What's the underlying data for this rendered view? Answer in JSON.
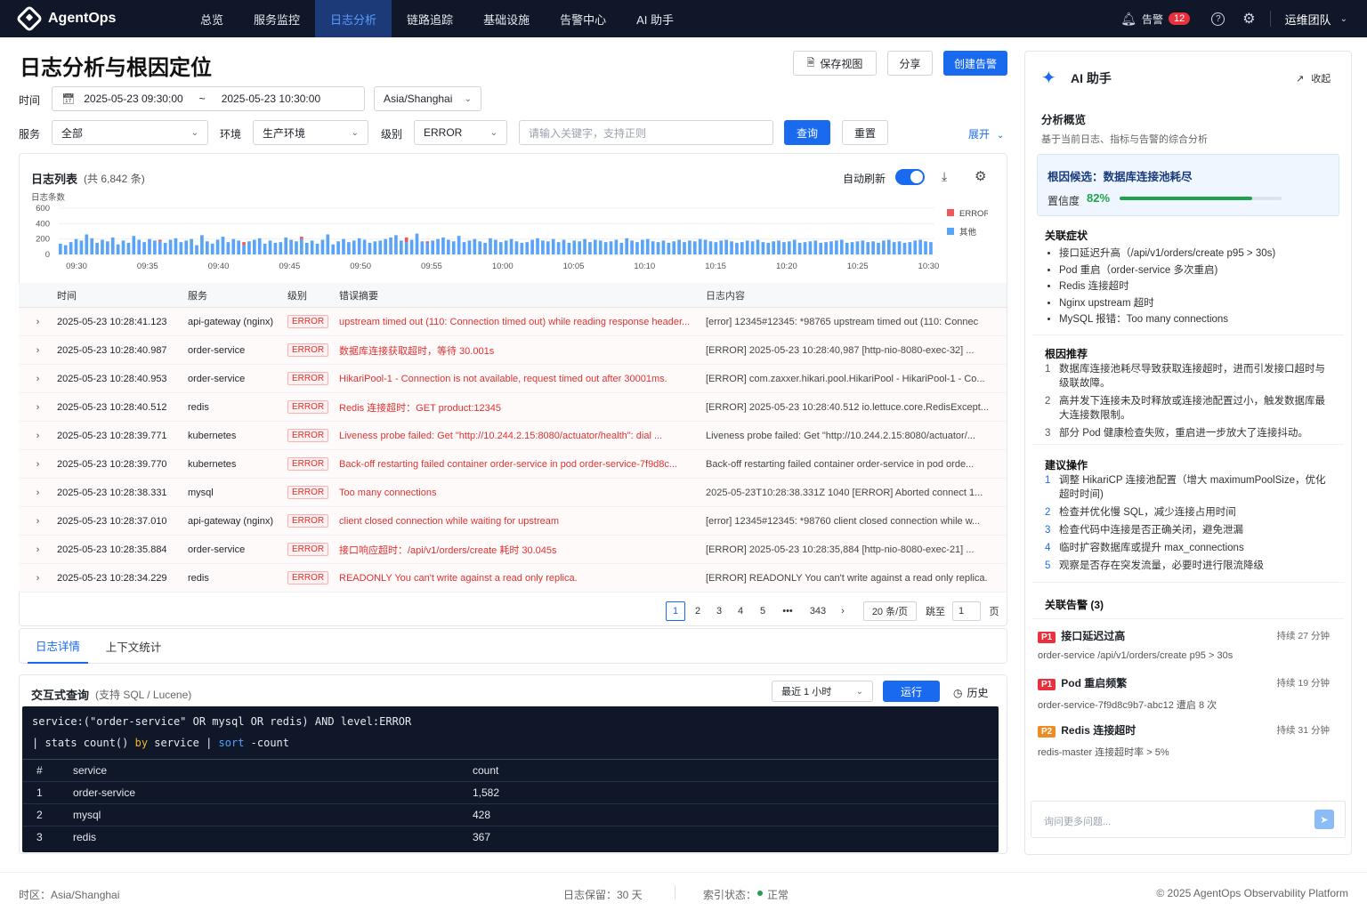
{
  "nav": {
    "brand": "AgentOps",
    "items": [
      "总览",
      "服务监控",
      "日志分析",
      "链路追踪",
      "基础设施",
      "告警中心",
      "AI 助手"
    ],
    "active_index": 2,
    "alert_label": "告警",
    "alert_count": "12",
    "team": "运维团队"
  },
  "page": {
    "title": "日志分析与根因定位",
    "save_view": "保存视图",
    "share": "分享",
    "create_alert": "创建告警"
  },
  "filters": {
    "time_label": "时间",
    "time_start": "2025-05-23 09:30:00",
    "time_sep": "~",
    "time_end": "2025-05-23 10:30:00",
    "timezone": "Asia/Shanghai",
    "service_label": "服务",
    "service_value": "全部",
    "env_label": "环境",
    "env_value": "生产环境",
    "level_label": "级别",
    "level_value": "ERROR",
    "search_placeholder": "请输入关键字，支持正则",
    "query_btn": "查询",
    "reset_btn": "重置",
    "expand": "展开"
  },
  "log_list": {
    "title": "日志列表",
    "count_text": "(共 6,842 条)",
    "auto_refresh_label": "自动刷新",
    "auto_refresh_on": true
  },
  "chart_data": {
    "type": "bar",
    "stacked": true,
    "ylabel": "日志条数",
    "y_ticks": [
      0,
      200,
      400,
      600
    ],
    "ylim": [
      0,
      600
    ],
    "x_ticks": [
      "09:30",
      "09:35",
      "09:40",
      "09:45",
      "09:50",
      "09:55",
      "10:00",
      "10:05",
      "10:10",
      "10:15",
      "10:20",
      "10:25",
      "10:30"
    ],
    "series": [
      {
        "name": "ERROR",
        "color": "#f0585b",
        "values": [
          0,
          0,
          0,
          0,
          0,
          0,
          0,
          0,
          0,
          0,
          0,
          0,
          0,
          0,
          0,
          0,
          0,
          0,
          0,
          20,
          0,
          0,
          0,
          0,
          0,
          0,
          0,
          0,
          0,
          0,
          0,
          0,
          0,
          0,
          0,
          40,
          0,
          0,
          0,
          0,
          0,
          0,
          0,
          0,
          0,
          0,
          30,
          0,
          0,
          0,
          0,
          0,
          0,
          0,
          0,
          0,
          0,
          0,
          0,
          0,
          0,
          0,
          0,
          0,
          0,
          0,
          60,
          0,
          0,
          0,
          20,
          0,
          0,
          0,
          0,
          0,
          0,
          0,
          0,
          0,
          0,
          0,
          0,
          0,
          0,
          0,
          0,
          0,
          0,
          0,
          0,
          0,
          0,
          0,
          0,
          0,
          0,
          0,
          0,
          0,
          0,
          0,
          0,
          0,
          0,
          0,
          0,
          0,
          0,
          0,
          0,
          0,
          0,
          0,
          0,
          0,
          0,
          0,
          0,
          0,
          0,
          0,
          0,
          0,
          0
        ]
      },
      {
        "name": "其他",
        "color": "#5aa4f8",
        "values": [
          140,
          120,
          160,
          200,
          180,
          260,
          210,
          150,
          190,
          170,
          220,
          130,
          180,
          150,
          240,
          190,
          160,
          200,
          180,
          170,
          150,
          190,
          210,
          160,
          180,
          200,
          120,
          250,
          170,
          140,
          190,
          230,
          160,
          200,
          180,
          120,
          170,
          190,
          210,
          140,
          180,
          150,
          160,
          220,
          190,
          170,
          200,
          150,
          180,
          140,
          190,
          260,
          130,
          170,
          200,
          160,
          180,
          210,
          190,
          150,
          170,
          180,
          200,
          220,
          250,
          180,
          160,
          190,
          270,
          170,
          150,
          180,
          200,
          220,
          190,
          170,
          240,
          160,
          180,
          200,
          170,
          150,
          210,
          190,
          160,
          180,
          200,
          170,
          150,
          160,
          190,
          210,
          180,
          170,
          200,
          160,
          190,
          150,
          180,
          170,
          200,
          160,
          190,
          180,
          160,
          170,
          190,
          150,
          210,
          180,
          160,
          190,
          200,
          170,
          160,
          180,
          150,
          170,
          190,
          160,
          180,
          170,
          200,
          190,
          170,
          160,
          180,
          190,
          170,
          150,
          160,
          180,
          170,
          190,
          160,
          150,
          170,
          180,
          160,
          170,
          190,
          150,
          160,
          170,
          180,
          150,
          160,
          170,
          180,
          190,
          150,
          160,
          170,
          180,
          160,
          170,
          150,
          180,
          190,
          160,
          170,
          150,
          160,
          180,
          190,
          170,
          160
        ]
      }
    ],
    "legend_position": "right"
  },
  "log_table": {
    "headers": [
      "时间",
      "服务",
      "级别",
      "错误摘要",
      "日志内容"
    ],
    "rows": [
      {
        "time": "2025-05-23 10:28:41.123",
        "service": "api-gateway (nginx)",
        "level": "ERROR",
        "summary": "upstream timed out (110: Connection timed out) while reading response header...",
        "content": "[error] 12345#12345: *98765 upstream timed out (110: Connec"
      },
      {
        "time": "2025-05-23 10:28:40.987",
        "service": "order-service",
        "level": "ERROR",
        "summary": "数据库连接获取超时，等待 30.001s",
        "content": "[ERROR] 2025-05-23 10:28:40,987 [http-nio-8080-exec-32] ..."
      },
      {
        "time": "2025-05-23 10:28:40.953",
        "service": "order-service",
        "level": "ERROR",
        "summary": "HikariPool-1 - Connection is not available, request timed out after 30001ms.",
        "content": "[ERROR] com.zaxxer.hikari.pool.HikariPool - HikariPool-1 - Co..."
      },
      {
        "time": "2025-05-23 10:28:40.512",
        "service": "redis",
        "level": "ERROR",
        "summary": "Redis 连接超时：GET product:12345",
        "content": "[ERROR] 2025-05-23 10:28:40.512 io.lettuce.core.RedisExcept..."
      },
      {
        "time": "2025-05-23 10:28:39.771",
        "service": "kubernetes",
        "level": "ERROR",
        "summary": "Liveness probe failed: Get \"http://10.244.2.15:8080/actuator/health\": dial ...",
        "content": "Liveness probe failed: Get \"http://10.244.2.15:8080/actuator/..."
      },
      {
        "time": "2025-05-23 10:28:39.770",
        "service": "kubernetes",
        "level": "ERROR",
        "summary": "Back-off restarting failed container order-service in pod order-service-7f9d8c...",
        "content": "Back-off restarting failed container order-service in pod orde..."
      },
      {
        "time": "2025-05-23 10:28:38.331",
        "service": "mysql",
        "level": "ERROR",
        "summary": "Too many connections",
        "content": "2025-05-23T10:28:38.331Z 1040 [ERROR] Aborted connect 1..."
      },
      {
        "time": "2025-05-23 10:28:37.010",
        "service": "api-gateway (nginx)",
        "level": "ERROR",
        "summary": "client closed connection while waiting for upstream",
        "content": "[error] 12345#12345: *98760 client closed connection while w..."
      },
      {
        "time": "2025-05-23 10:28:35.884",
        "service": "order-service",
        "level": "ERROR",
        "summary": "接口响应超时：/api/v1/orders/create 耗时 30.045s",
        "content": "[ERROR] 2025-05-23 10:28:35,884 [http-nio-8080-exec-21] ..."
      },
      {
        "time": "2025-05-23 10:28:34.229",
        "service": "redis",
        "level": "ERROR",
        "summary": "READONLY You can't write against a read only replica.",
        "content": "[ERROR] READONLY You can't write against a read only replica."
      }
    ]
  },
  "pagination": {
    "pages": [
      "1",
      "2",
      "3",
      "4",
      "5",
      "•••",
      "343"
    ],
    "current": "1",
    "page_size": "20 条/页",
    "jump_label": "跳至",
    "jump_value": "1",
    "page_unit": "页"
  },
  "detail_tabs": [
    "日志详情",
    "上下文统计"
  ],
  "query": {
    "title": "交互式查询",
    "subtitle": "(支持 SQL / Lucene)",
    "range": "最近 1 小时",
    "run": "运行",
    "history": "历史",
    "line1": "service:(\"order-service\" OR mysql OR redis) AND level:ERROR",
    "line2_a": "| stats count() ",
    "line2_by": "by",
    "line2_b": " service | ",
    "line2_sort": "sort",
    "line2_c": " -count",
    "headers": [
      "#",
      "service",
      "count"
    ],
    "rows": [
      {
        "n": "1",
        "service": "order-service",
        "count": "1,582"
      },
      {
        "n": "2",
        "service": "mysql",
        "count": "428"
      },
      {
        "n": "3",
        "service": "redis",
        "count": "367"
      }
    ]
  },
  "ai": {
    "title": "AI 助手",
    "collapse": "收起",
    "overview_title": "分析概览",
    "overview_desc": "基于当前日志、指标与告警的综合分析",
    "root_cause_label": "根因候选：数据库连接池耗尽",
    "confidence_label": "置信度",
    "confidence": "82%",
    "confidence_value": 0.82,
    "symptoms_title": "关联症状",
    "symptoms": [
      "接口延迟升高（/api/v1/orders/create p95 > 30s)",
      "Pod 重启（order-service 多次重启)",
      "Redis 连接超时",
      "Nginx upstream 超时",
      "MySQL 报错：Too many connections"
    ],
    "recommend_title": "根因推荐",
    "recommend": [
      {
        "n": "1",
        "text": "数据库连接池耗尽导致获取连接超时，进而引发接口超时与级联故障。"
      },
      {
        "n": "2",
        "text": "高并发下连接未及时释放或连接池配置过小，触发数据库最大连接数限制。"
      },
      {
        "n": "3",
        "text": "部分 Pod 健康检查失败，重启进一步放大了连接抖动。"
      }
    ],
    "actions_title": "建议操作",
    "actions": [
      {
        "n": "1",
        "text": "调整 HikariCP 连接池配置（增大 maximumPoolSize，优化超时时间)"
      },
      {
        "n": "2",
        "text": "检查并优化慢 SQL，减少连接占用时间"
      },
      {
        "n": "3",
        "text": "检查代码中连接是否正确关闭，避免泄漏"
      },
      {
        "n": "4",
        "text": "临时扩容数据库或提升 max_connections"
      },
      {
        "n": "5",
        "text": "观察是否存在突发流量，必要时进行限流降级"
      }
    ],
    "alerts_title": "关联告警 (3)",
    "alerts": [
      {
        "level": "P1",
        "color": "#e8313c",
        "title": "接口延迟过高",
        "duration": "持续 27 分钟",
        "desc": "order-service /api/v1/orders/create p95 > 30s"
      },
      {
        "level": "P1",
        "color": "#e8313c",
        "title": "Pod 重启频繁",
        "duration": "持续 19 分钟",
        "desc": "order-service-7f9d8c9b7-abc12 遭启 8 次"
      },
      {
        "level": "P2",
        "color": "#f08a24",
        "title": "Redis 连接超时",
        "duration": "持续 31 分钟",
        "desc": "redis-master 连接超时率 > 5%"
      }
    ],
    "ask_placeholder": "询问更多问题..."
  },
  "footer": {
    "timezone": "时区：Asia/Shanghai",
    "retention": "日志保留：30 天",
    "index_status_label": "索引状态：",
    "index_status": "正常",
    "copyright": "© 2025 AgentOps Observability Platform"
  }
}
